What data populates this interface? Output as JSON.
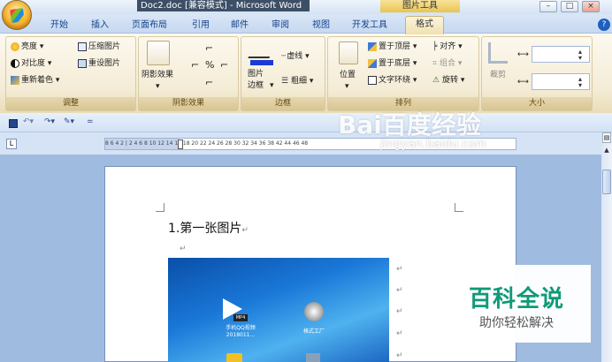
{
  "window": {
    "title": "Doc2.doc [兼容模式] - Microsoft Word",
    "context_tab_group": "图片工具",
    "buttons": {
      "minimize": "–",
      "maximize": "□",
      "close": "×"
    }
  },
  "ribbon_tabs": [
    "开始",
    "插入",
    "页面布局",
    "引用",
    "邮件",
    "审阅",
    "视图",
    "开发工具",
    "格式"
  ],
  "active_tab": "格式",
  "groups": {
    "adjust": {
      "label": "调整",
      "items": [
        "亮度",
        "对比度",
        "重新着色",
        "压缩图片",
        "重设图片"
      ]
    },
    "shadow": {
      "label": "阴影效果",
      "big_button": "阴影效果"
    },
    "border": {
      "label": "边框",
      "big_button_line1": "图片",
      "big_button_line2": "边框",
      "items": [
        "虚线",
        "粗细"
      ]
    },
    "arrange": {
      "label": "排列",
      "position": "位置",
      "items": [
        "置于顶层",
        "对齐",
        "置于底层",
        "组合",
        "文字环绕",
        "旋转"
      ]
    },
    "size": {
      "label": "大小",
      "crop": "裁剪"
    }
  },
  "ruler": {
    "numbers": "8   6   4   2   |   2   4   6   8  10  12  14  16  18  20  22  24  26  28  30  32  34  36  38     42  44  46  48"
  },
  "document": {
    "heading": "1.第一张图片",
    "paragraph_mark": "↵",
    "desktop_icons": [
      {
        "label_line1": "手机QQ视频",
        "label_line2": "2018011..."
      },
      {
        "label_line1": "格式工厂",
        "label_line2": ""
      }
    ]
  },
  "watermark": {
    "logo": "Bai百度经验",
    "url": "jingyan.baidu.com"
  },
  "badge": {
    "title": "百科全说",
    "subtitle": "助你轻松解决"
  },
  "colors": {
    "ribbon_bg": "#f4ecd6",
    "tab_text": "#15428b",
    "doc_bg": "#a0bbe0",
    "badge_green": "#0f9a78"
  }
}
